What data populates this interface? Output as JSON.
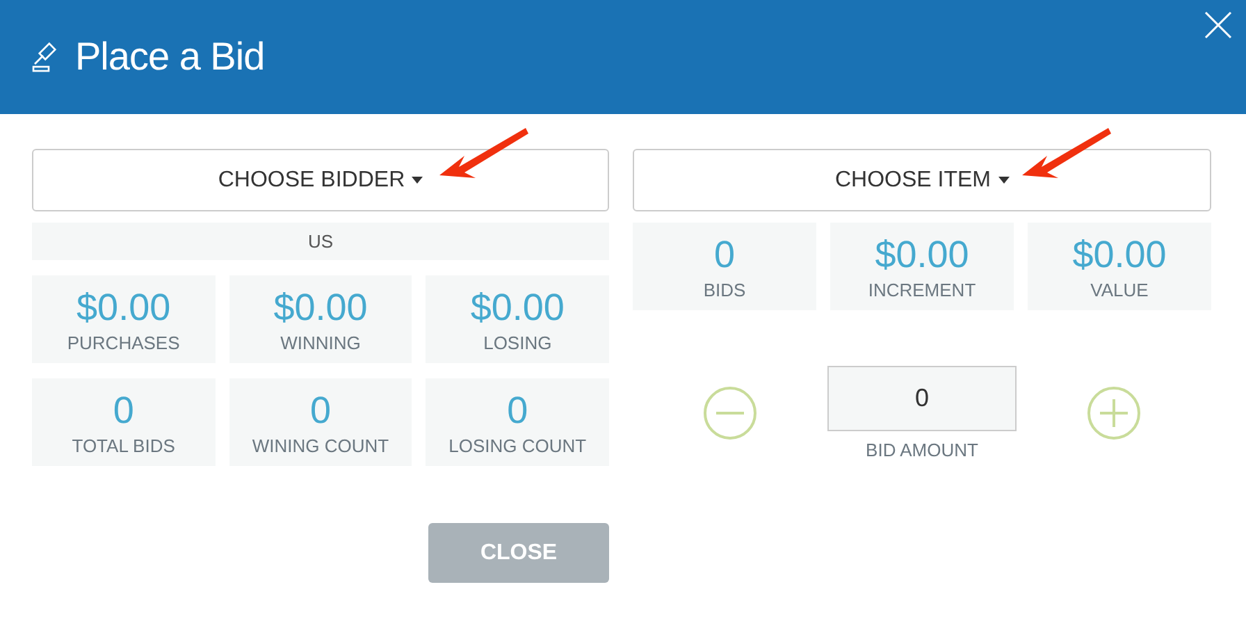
{
  "dialog": {
    "title": "Place a Bid"
  },
  "bidder": {
    "button": "CHOOSE BIDDER",
    "currency": "US",
    "stats": [
      {
        "value": "$0.00",
        "label": "PURCHASES"
      },
      {
        "value": "$0.00",
        "label": "WINNING"
      },
      {
        "value": "$0.00",
        "label": "LOSING"
      },
      {
        "value": "0",
        "label": "TOTAL BIDS"
      },
      {
        "value": "0",
        "label": "WINING COUNT"
      },
      {
        "value": "0",
        "label": "LOSING COUNT"
      }
    ]
  },
  "item": {
    "button": "CHOOSE ITEM",
    "stats": [
      {
        "value": "0",
        "label": "BIDS"
      },
      {
        "value": "$0.00",
        "label": "INCREMENT"
      },
      {
        "value": "$0.00",
        "label": "VALUE"
      }
    ],
    "bid_amount": {
      "value": "0",
      "label": "BID AMOUNT"
    }
  },
  "buttons": [
    {
      "label": "CLOSE",
      "disabled": true
    }
  ]
}
